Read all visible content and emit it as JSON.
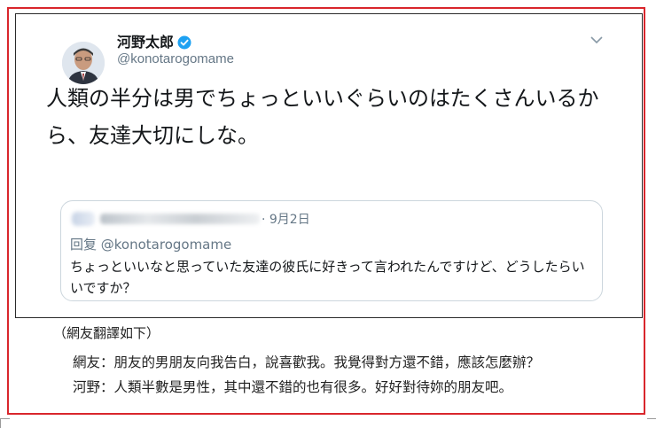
{
  "tweet": {
    "display_name": "河野太郎",
    "handle": "@konotarogomame",
    "text": "人類の半分は男でちょっといいぐらいのはたくさんいるから、友達大切にしな。",
    "verified": true,
    "quote": {
      "date": "· 9月2日",
      "reply_to": "回复 @konotarogomame",
      "text": "ちょっといいなと思っていた友達の彼氏に好きって言われたんですけど、どうしたらいいですか？"
    }
  },
  "caption": {
    "title": "（網友翻譯如下）",
    "line1": "網友：朋友的男朋友向我告白，說喜歡我。我覺得對方還不錯，應該怎麼辦？",
    "line2": "河野：人類半數是男性，其中還不錯的也有很多。好好對待妳的朋友吧。"
  },
  "colors": {
    "frame": "#d9262c",
    "verified": "#1da1f2",
    "muted": "#657786"
  },
  "icons": [
    "avatar",
    "verified-badge-icon",
    "chevron-down-icon"
  ]
}
